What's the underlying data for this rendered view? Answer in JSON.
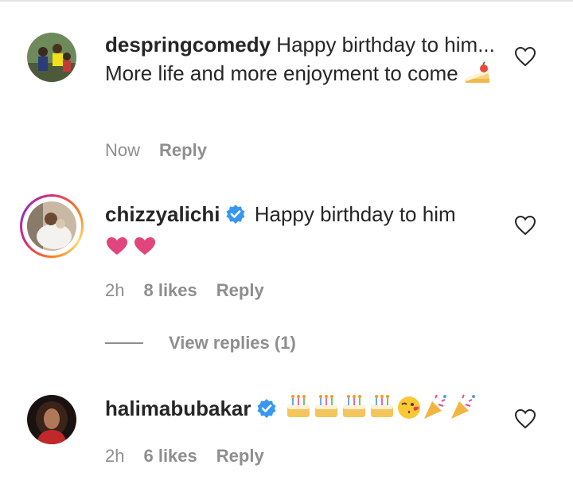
{
  "comments": [
    {
      "username": "despringcomedy",
      "text": "Happy birthday to him... More life and more enjoyment to come",
      "emoji": "cake-slice-icon",
      "time": "Now",
      "likes": "",
      "reply_label": "Reply",
      "verified": false
    },
    {
      "username": "chizzyalichi",
      "text": "Happy birthday to him",
      "emoji": "two-pink-hearts-icon",
      "time": "2h",
      "likes": "8 likes",
      "reply_label": "Reply",
      "verified": true,
      "has_story_ring": true
    },
    {
      "username": "halimabubakar",
      "text": "",
      "emoji": "cakes-kiss-party-poppers-icons",
      "time": "2h",
      "likes": "6 likes",
      "reply_label": "Reply",
      "verified": true
    }
  ],
  "view_replies_label": "View replies (1)",
  "colors": {
    "text": "#262626",
    "meta": "#8e8e8e",
    "verified": "#3897f0",
    "heart_pink": "#e0457b"
  }
}
